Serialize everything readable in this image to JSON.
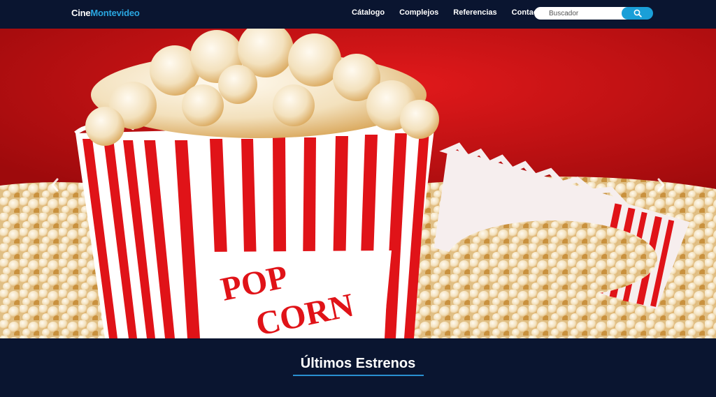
{
  "brand": {
    "prefix": "Cine",
    "accent": "Montevideo"
  },
  "nav": {
    "items": [
      "Cátalogo",
      "Complejos",
      "Referencias",
      "Contacto"
    ]
  },
  "search": {
    "placeholder": "Buscador",
    "icon": "search-icon"
  },
  "hero": {
    "box_text_line1": "POP",
    "box_text_line2": "CORN",
    "prev_icon": "chevron-left-icon",
    "next_icon": "chevron-right-icon"
  },
  "section": {
    "title": "Últimos Estrenos"
  },
  "colors": {
    "navbar": "#0a1530",
    "accent": "#2aa6e0",
    "button": "#1a9fd8",
    "stripe_red": "#e01318"
  }
}
